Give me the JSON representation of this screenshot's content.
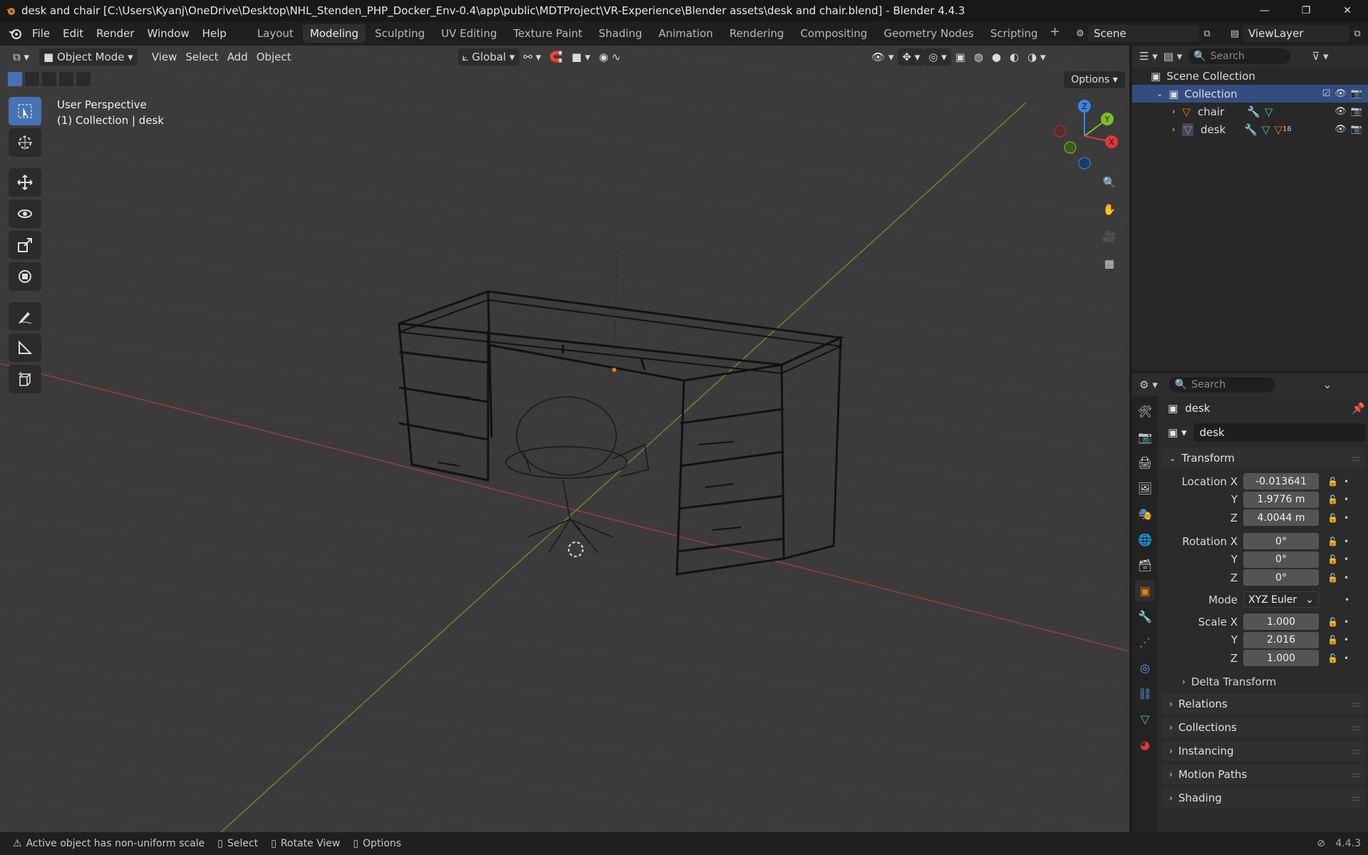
{
  "window": {
    "title": "desk and chair [C:\\Users\\Kyanj\\OneDrive\\Desktop\\NHL_Stenden_PHP_Docker_Env-0.4\\app\\public\\MDTProject\\VR-Experience\\Blender assets\\desk and chair.blend] - Blender 4.4.3",
    "minimize": "—",
    "maximize": "❐",
    "close": "✕"
  },
  "menu": [
    "File",
    "Edit",
    "Render",
    "Window",
    "Help"
  ],
  "workspaces": [
    {
      "label": "Layout",
      "active": false
    },
    {
      "label": "Modeling",
      "active": true
    },
    {
      "label": "Sculpting",
      "active": false
    },
    {
      "label": "UV Editing",
      "active": false
    },
    {
      "label": "Texture Paint",
      "active": false
    },
    {
      "label": "Shading",
      "active": false
    },
    {
      "label": "Animation",
      "active": false
    },
    {
      "label": "Rendering",
      "active": false
    },
    {
      "label": "Compositing",
      "active": false
    },
    {
      "label": "Geometry Nodes",
      "active": false
    },
    {
      "label": "Scripting",
      "active": false
    }
  ],
  "scene": {
    "name": "Scene",
    "view_layer": "ViewLayer"
  },
  "viewport": {
    "mode": "Object Mode",
    "menus": [
      "View",
      "Select",
      "Add",
      "Object"
    ],
    "orientation": "Global",
    "options_label": "Options",
    "perspective": "User Perspective",
    "context": "(1) Collection | desk",
    "gizmo": {
      "x": "X",
      "y": "Y",
      "z": "Z"
    }
  },
  "outliner": {
    "search_placeholder": "Search",
    "scene_collection": "Scene Collection",
    "collection": "Collection",
    "objects": [
      {
        "name": "chair",
        "modifier_count": ""
      },
      {
        "name": "desk",
        "modifier_count": "16"
      }
    ]
  },
  "properties": {
    "search_placeholder": "Search",
    "object_name": "desk",
    "object_field": "desk",
    "transform_label": "Transform",
    "location": {
      "label": "Location X",
      "x": "-0.013641",
      "y": "1.9776 m",
      "z": "4.0044 m"
    },
    "rotation": {
      "label": "Rotation X",
      "x": "0°",
      "y": "0°",
      "z": "0°"
    },
    "mode": {
      "label": "Mode",
      "value": "XYZ Euler"
    },
    "scale": {
      "label": "Scale X",
      "x": "1.000",
      "y": "2.016",
      "z": "1.000"
    },
    "axis_y": "Y",
    "axis_z": "Z",
    "delta_transform": "Delta Transform",
    "panels": [
      "Relations",
      "Collections",
      "Instancing",
      "Motion Paths",
      "Shading"
    ]
  },
  "statusbar": {
    "warning": "Active object has non-uniform scale",
    "select": "Select",
    "rotate": "Rotate View",
    "options": "Options",
    "version": "4.4.3"
  },
  "colors": {
    "accent": "#4772b3",
    "x_axis": "#e2363c",
    "y_axis": "#7cbf26",
    "z_axis": "#3b82e6",
    "viewport_bg": "#3b3b3b"
  }
}
